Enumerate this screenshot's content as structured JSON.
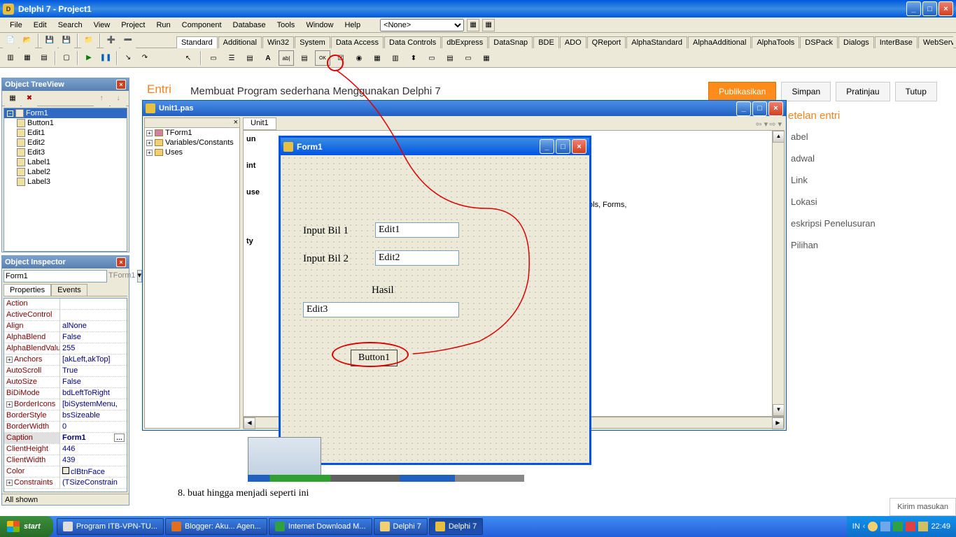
{
  "app": {
    "title": "Delphi 7 - Project1"
  },
  "menu": [
    "File",
    "Edit",
    "Search",
    "View",
    "Project",
    "Run",
    "Component",
    "Database",
    "Tools",
    "Window",
    "Help"
  ],
  "menu_combo": "<None>",
  "palette_tabs": [
    "Standard",
    "Additional",
    "Win32",
    "System",
    "Data Access",
    "Data Controls",
    "dbExpress",
    "DataSnap",
    "BDE",
    "ADO",
    "QReport",
    "AlphaStandard",
    "AlphaAdditional",
    "AlphaTools",
    "DSPack",
    "Dialogs",
    "InterBase",
    "WebServices"
  ],
  "treeview": {
    "title": "Object TreeView",
    "root": "Form1",
    "items": [
      "Button1",
      "Edit1",
      "Edit2",
      "Edit3",
      "Label1",
      "Label2",
      "Label3"
    ]
  },
  "inspector": {
    "title": "Object Inspector",
    "object": "Form1",
    "objtype": "TForm1",
    "tabs": [
      "Properties",
      "Events"
    ],
    "rows": [
      {
        "k": "Action",
        "v": ""
      },
      {
        "k": "ActiveControl",
        "v": ""
      },
      {
        "k": "Align",
        "v": "alNone"
      },
      {
        "k": "AlphaBlend",
        "v": "False"
      },
      {
        "k": "AlphaBlendValue",
        "v": "255"
      },
      {
        "k": "Anchors",
        "v": "[akLeft,akTop]",
        "plus": true
      },
      {
        "k": "AutoScroll",
        "v": "True"
      },
      {
        "k": "AutoSize",
        "v": "False"
      },
      {
        "k": "BiDiMode",
        "v": "bdLeftToRight"
      },
      {
        "k": "BorderIcons",
        "v": "[biSystemMenu,",
        "plus": true
      },
      {
        "k": "BorderStyle",
        "v": "bsSizeable"
      },
      {
        "k": "BorderWidth",
        "v": "0"
      },
      {
        "k": "Caption",
        "v": "Form1",
        "sel": true
      },
      {
        "k": "ClientHeight",
        "v": "446"
      },
      {
        "k": "ClientWidth",
        "v": "439"
      },
      {
        "k": "Color",
        "v": "clBtnFace",
        "checkbox": true
      },
      {
        "k": "Constraints",
        "v": "(TSizeConstrain",
        "plus": true
      }
    ],
    "status": "All shown"
  },
  "codewin": {
    "title": "Unit1.pas",
    "tab": "Unit1",
    "explorer": [
      "TForm1",
      "Variables/Constants",
      "Uses"
    ],
    "snippets": {
      "un": "un",
      "int": "int",
      "use": "use",
      "ty": "ty",
      "ctrls": ", Controls, Forms,"
    }
  },
  "form": {
    "title": "Form1",
    "label1": "Input Bil 1",
    "label2": "Input Bil 2",
    "label3": "Hasil",
    "edit1": "Edit1",
    "edit2": "Edit2",
    "edit3": "Edit3",
    "button1": "Button1"
  },
  "blogger": {
    "entri": "Entri",
    "title": "Membuat Program sederhana Menggunakan Delphi 7",
    "publish": "Publikasikan",
    "save": "Simpan",
    "preview": "Pratinjau",
    "close": "Tutup",
    "settings_title": "etelan entri",
    "items": [
      "abel",
      "adwal",
      "Link",
      "Lokasi",
      "eskripsi Penelusuran",
      "Pilihan"
    ]
  },
  "bottom": {
    "text": "8.  buat hingga menjadi seperti ini"
  },
  "taskbar": {
    "start": "start",
    "items": [
      {
        "label": "Program ITB-VPN-TU...",
        "icon": "#ddd"
      },
      {
        "label": "Blogger: Aku... Agen...",
        "icon": "#e07020"
      },
      {
        "label": "Internet Download M...",
        "icon": "#30a040"
      },
      {
        "label": "Delphi 7",
        "icon": "#f0d070"
      },
      {
        "label": "Delphi 7",
        "icon": "#e8c040",
        "active": true
      }
    ],
    "lang": "IN",
    "time": "22:49"
  },
  "feedback": "Kirim masukan"
}
